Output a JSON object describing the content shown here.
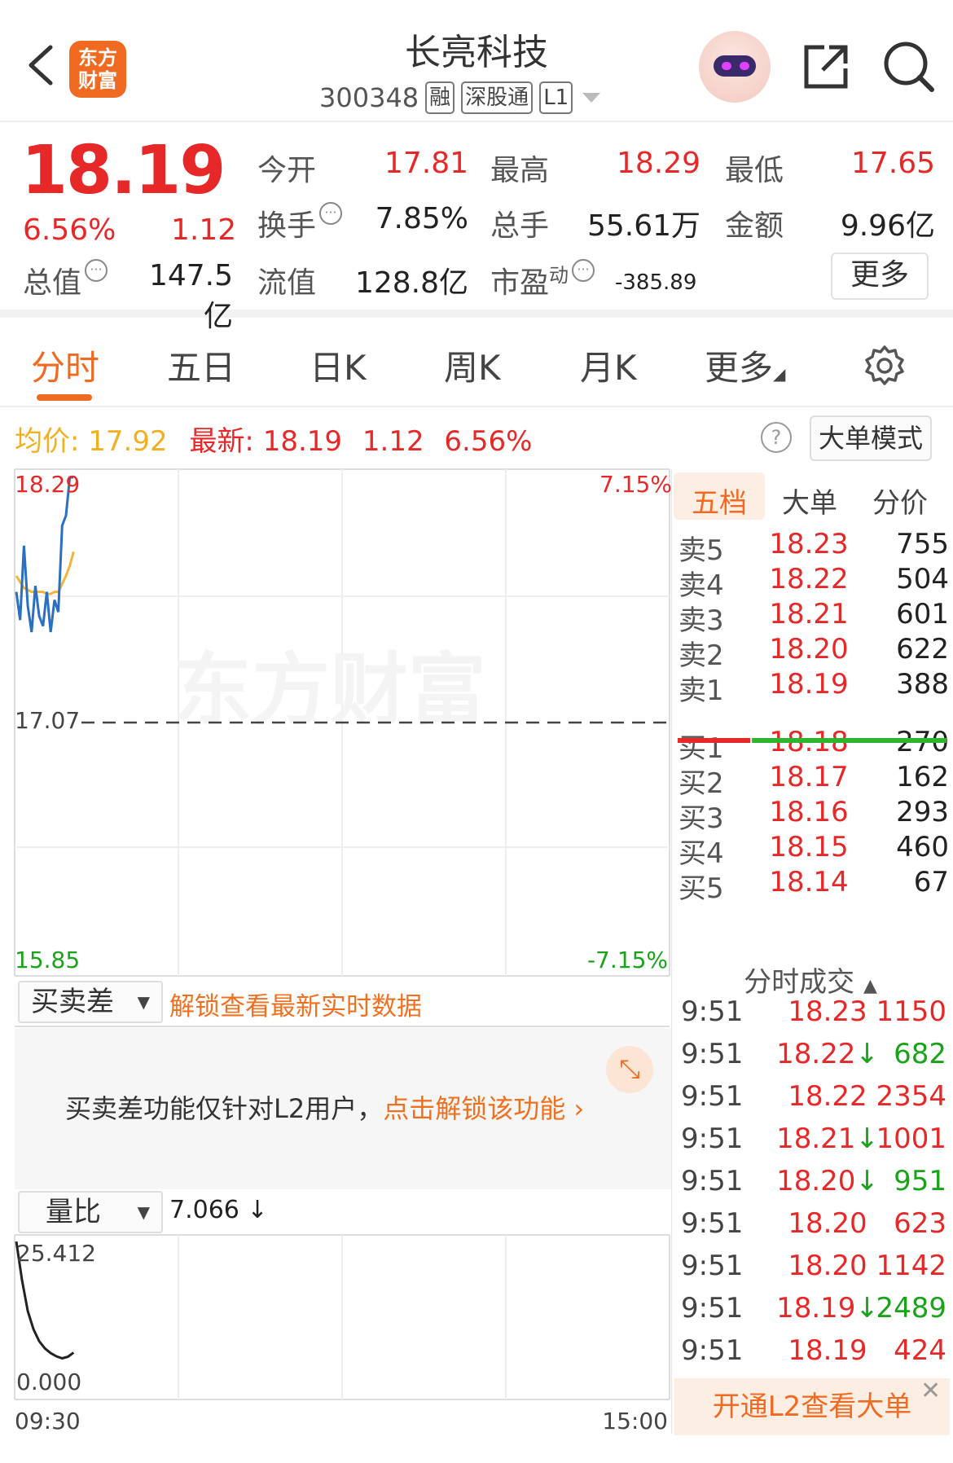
{
  "header": {
    "logo_line1": "东方",
    "logo_line2": "财富",
    "stock_name": "长亮科技",
    "stock_code": "300348",
    "tags": [
      "融",
      "深股通",
      "L1"
    ]
  },
  "quote": {
    "price": "18.19",
    "change_pct": "6.56%",
    "change_amt": "1.12",
    "fields": [
      {
        "label": "今开",
        "value": "17.81",
        "color": "#e62828"
      },
      {
        "label": "最高",
        "value": "18.29",
        "color": "#e62828"
      },
      {
        "label": "最低",
        "value": "17.65",
        "color": "#e62828"
      },
      {
        "label": "换手",
        "value": "7.85%",
        "color": "#222222"
      },
      {
        "label": "总手",
        "value": "55.61万",
        "color": "#222222"
      },
      {
        "label": "金额",
        "value": "9.96亿",
        "color": "#222222"
      },
      {
        "label": "总值",
        "value": "147.5亿",
        "color": "#222222"
      },
      {
        "label": "流值",
        "value": "128.8亿",
        "color": "#222222"
      },
      {
        "label": "市盈",
        "value": "-385.89",
        "color": "#222222"
      }
    ],
    "pe_superscript": "动",
    "more_label": "更多"
  },
  "tabs": [
    "分时",
    "五日",
    "日K",
    "周K",
    "月K",
    "更多"
  ],
  "avg_row": {
    "avg_label": "均价:",
    "avg_value": "17.92",
    "latest_label": "最新:",
    "latest_value": "18.19",
    "latest_change": "1.12",
    "latest_pct": "6.56%",
    "help": "?",
    "mode_button": "大单模式"
  },
  "chart_data": {
    "type": "line",
    "y_labels_left": [
      "18.29",
      "17.07",
      "15.85"
    ],
    "y_labels_right": [
      "7.15%",
      "-7.15%"
    ],
    "ylim": [
      15.85,
      18.29
    ],
    "prev_close": 17.07,
    "watermark": "东方财富",
    "series": [
      {
        "values": [
          17.72,
          17.58,
          17.95,
          17.65,
          17.52,
          17.75,
          17.6,
          17.55,
          17.72,
          17.52,
          17.68,
          17.62,
          18.05,
          18.1,
          18.29,
          18.29
        ]
      },
      {
        "values": [
          17.8,
          17.77,
          17.74,
          17.73,
          17.72,
          17.72,
          17.72,
          17.72,
          17.71,
          17.71,
          17.72,
          17.72,
          17.76,
          17.8,
          17.85,
          17.92
        ]
      }
    ],
    "volume_ratio": {
      "y_labels": [
        "25.412",
        "0.000"
      ],
      "ylim": [
        0,
        25.412
      ],
      "values": [
        25.4,
        18,
        12,
        8.5,
        6.2,
        4.8,
        3.9,
        3.3,
        2.9,
        3.2,
        4.0
      ],
      "x_labels": [
        "09:30",
        "15:00"
      ]
    }
  },
  "order_book": {
    "tabs": [
      "五档",
      "大单",
      "分价"
    ],
    "asks": [
      {
        "label": "卖5",
        "price": "18.23",
        "vol": "755"
      },
      {
        "label": "卖4",
        "price": "18.22",
        "vol": "504"
      },
      {
        "label": "卖3",
        "price": "18.21",
        "vol": "601"
      },
      {
        "label": "卖2",
        "price": "18.20",
        "vol": "622"
      },
      {
        "label": "卖1",
        "price": "18.19",
        "vol": "388"
      }
    ],
    "bids": [
      {
        "label": "买1",
        "price": "18.18",
        "vol": "270"
      },
      {
        "label": "买2",
        "price": "18.17",
        "vol": "162"
      },
      {
        "label": "买3",
        "price": "18.16",
        "vol": "293"
      },
      {
        "label": "买4",
        "price": "18.15",
        "vol": "460"
      },
      {
        "label": "买5",
        "price": "18.14",
        "vol": "67"
      }
    ],
    "buy_ratio": 0.27
  },
  "trades": {
    "title": "分时成交",
    "rows": [
      {
        "time": "9:51",
        "price": "18.23",
        "down": false,
        "vol": "1150",
        "color": "#e62828"
      },
      {
        "time": "9:51",
        "price": "18.22",
        "down": true,
        "vol": "682",
        "color": "#1aa31a"
      },
      {
        "time": "9:51",
        "price": "18.22",
        "down": false,
        "vol": "2354",
        "color": "#e62828"
      },
      {
        "time": "9:51",
        "price": "18.21",
        "down": true,
        "vol": "1001",
        "color": "#e62828"
      },
      {
        "time": "9:51",
        "price": "18.20",
        "down": true,
        "vol": "951",
        "color": "#1aa31a"
      },
      {
        "time": "9:51",
        "price": "18.20",
        "down": false,
        "vol": "623",
        "color": "#e62828"
      },
      {
        "time": "9:51",
        "price": "18.20",
        "down": false,
        "vol": "1142",
        "color": "#e62828"
      },
      {
        "time": "9:51",
        "price": "18.19",
        "down": true,
        "vol": "2489",
        "color": "#1aa31a"
      },
      {
        "time": "9:51",
        "price": "18.19",
        "down": false,
        "vol": "424",
        "color": "#e62828"
      }
    ],
    "l2_banner": "开通L2查看大单"
  },
  "bid_ask_panel": {
    "dropdown": "买卖差",
    "unlock_link": "解锁查看最新实时数据",
    "message": "买卖差功能仅针对L2用户，",
    "message_link": "点击解锁该功能"
  },
  "volume_panel": {
    "dropdown": "量比",
    "value": "7.066 ↓"
  }
}
